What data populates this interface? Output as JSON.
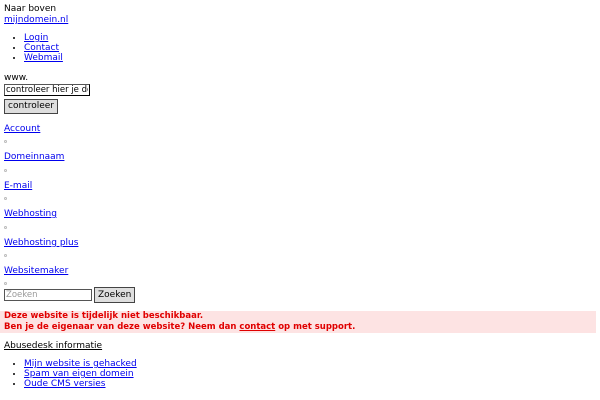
{
  "top": {
    "naar_boven": "Naar boven",
    "site_link": "mijndomein.nl"
  },
  "toplinks": [
    {
      "label": "Login"
    },
    {
      "label": "Contact"
    },
    {
      "label": "Webmail"
    }
  ],
  "domain_check": {
    "prefix": "www.",
    "input_value": "controleer hier je domein",
    "button_label": "controleer"
  },
  "nav": [
    {
      "label": "Account"
    },
    {
      "label": "Domeinnaam"
    },
    {
      "label": "E-mail"
    },
    {
      "label": "Webhosting"
    },
    {
      "label": "Webhosting plus"
    },
    {
      "label": "Websitemaker"
    }
  ],
  "search": {
    "placeholder": "Zoeken",
    "button_label": "Zoeken"
  },
  "notice": {
    "line1": "Deze website is tijdelijk niet beschikbaar.",
    "line2_before": "Ben je de eigenaar van deze website? Neem dan ",
    "line2_link": "contact",
    "line2_after": " op met support.",
    "color": "#e00000",
    "background": "#fde3e3"
  },
  "abuse": {
    "title": "Abusedesk informatie",
    "items": [
      {
        "label": "Mijn website is gehacked"
      },
      {
        "label": "Spam van eigen domein"
      },
      {
        "label": "Oude CMS versies"
      }
    ]
  }
}
